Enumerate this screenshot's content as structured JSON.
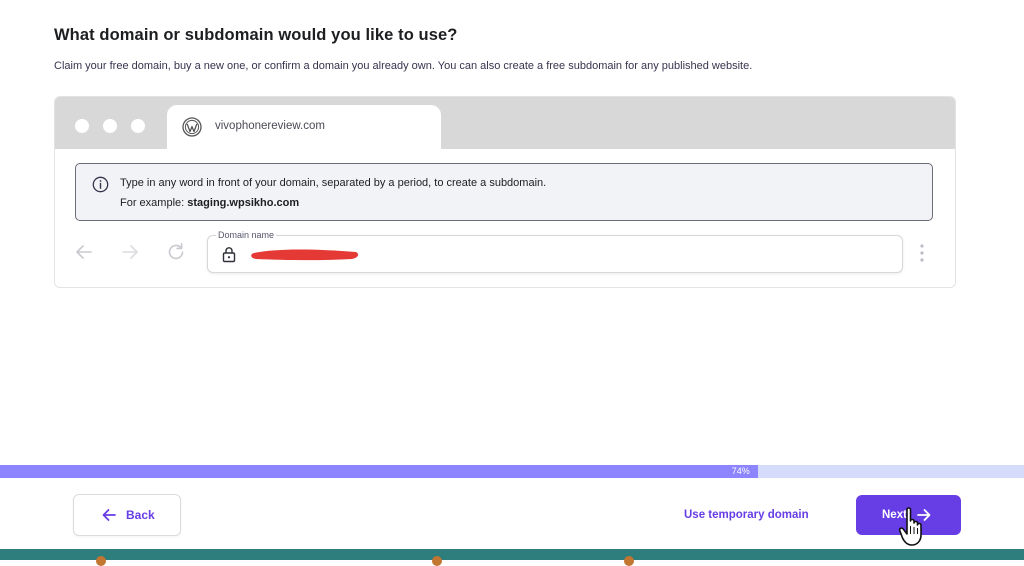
{
  "header": {
    "title": "What domain or subdomain would you like to use?",
    "subtitle": "Claim your free domain, buy a new one, or confirm a domain you already own. You can also create a free subdomain for any published website."
  },
  "browser_preview": {
    "tab_title": "vivophonereview.com",
    "tab_icon": "wordpress-icon",
    "info": {
      "icon": "info-icon",
      "line1": "Type in any word in front of your domain, separated by a period, to create a subdomain.",
      "example_prefix": "For example:",
      "example_value": "staging.wpsikho.com"
    },
    "domain_field": {
      "label": "Domain name",
      "value": "",
      "value_redacted": true
    }
  },
  "progress": {
    "label": "74%",
    "value": 0.74
  },
  "footer": {
    "back_label": "Back",
    "temporary_domain_label": "Use temporary domain",
    "next_label": "Next"
  },
  "colors": {
    "accent": "#673de6",
    "progress_fill": "#8c85ff",
    "progress_track": "#d5dcfb",
    "info_background": "#f2f3f6",
    "redaction": "#e53935",
    "taskbar": "#2f7e7e"
  }
}
